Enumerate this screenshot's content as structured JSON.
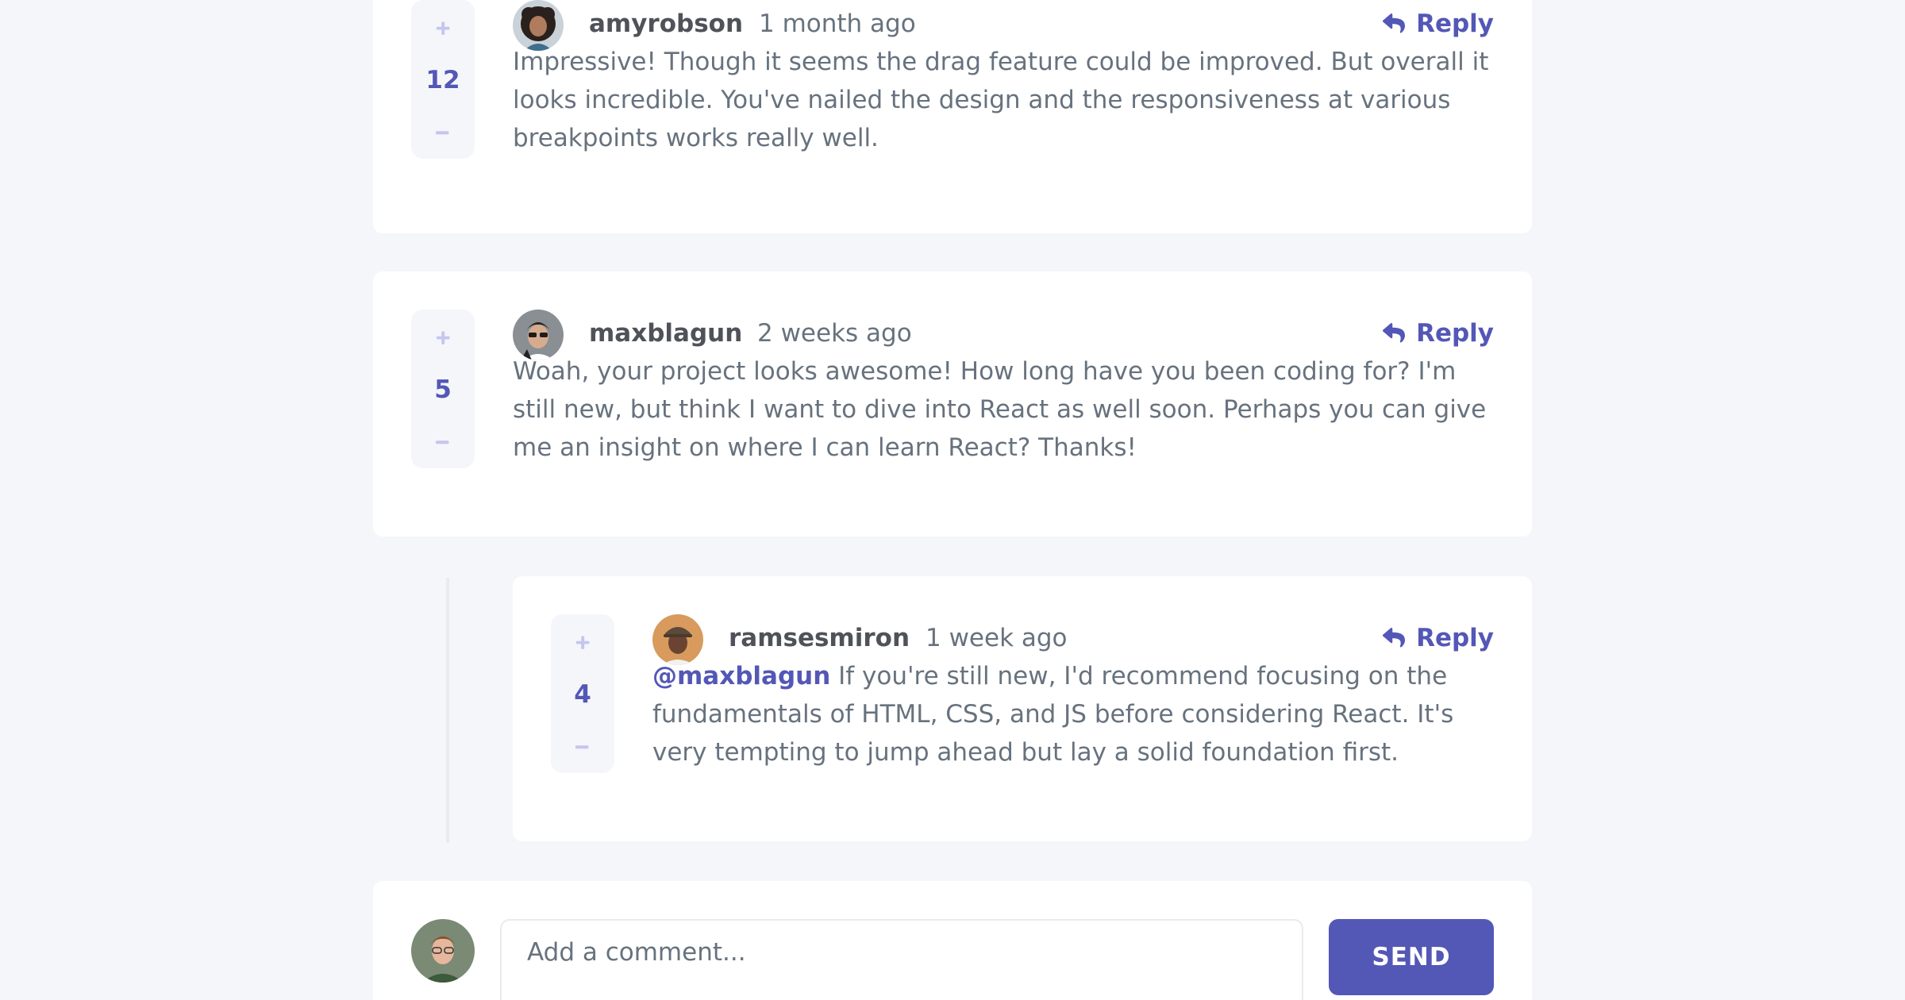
{
  "theme": {
    "accent": "#5357b6",
    "vote_light": "#c5c6ef",
    "text": "#67727e",
    "name": "#4f5258"
  },
  "comments": [
    {
      "username": "amyrobson",
      "time": "1 month ago",
      "score": "12",
      "reply_label": "Reply",
      "text": "Impressive! Though it seems the drag feature could be improved. But overall it looks incredible. You've nailed the design and the responsiveness at various breakpoints works really well."
    },
    {
      "username": "maxblagun",
      "time": "2 weeks ago",
      "score": "5",
      "reply_label": "Reply",
      "text": "Woah, your project looks awesome! How long have you been coding for? I'm still new, but think I want to dive into React as well soon. Perhaps you can give me an insight on where I can learn React? Thanks!"
    }
  ],
  "replies": [
    {
      "username": "ramsesmiron",
      "time": "1 week ago",
      "score": "4",
      "reply_label": "Reply",
      "mention": "@maxblagun",
      "text": "If you're still new, I'd recommend focusing on the fundamentals of HTML, CSS, and JS before considering React. It's very tempting to jump ahead but lay a solid foundation first."
    }
  ],
  "composer": {
    "placeholder": "Add a comment...",
    "send_label": "SEND"
  }
}
